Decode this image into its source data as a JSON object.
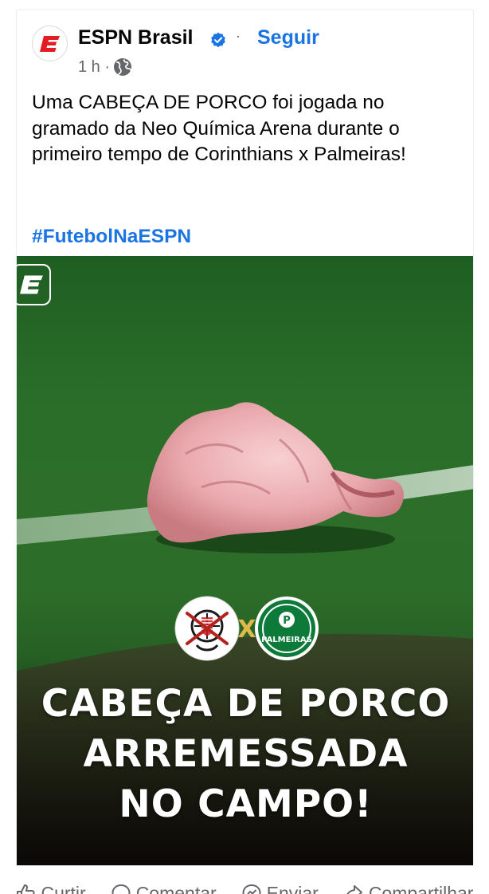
{
  "post": {
    "page_name": "ESPN Brasil",
    "separator": "·",
    "follow_label": "Seguir",
    "time": "1 h ·",
    "body_text": "Uma CABEÇA DE PORCO foi jogada no gramado da Neo Química Arena durante o primeiro tempo de Corinthians x Palmeiras!",
    "hashtag": "#FutebolNaESPN"
  },
  "media": {
    "headline_line1": "CABEÇA DE PORCO",
    "headline_line2": "ARREMESSADA",
    "headline_line3": "NO CAMPO!",
    "versus": "X",
    "palmeiras_crest_text": "PALMEIRAS"
  },
  "actions": {
    "like": "Curtir",
    "comment": "Comentar",
    "send": "Enviar",
    "share": "Compartilhar"
  },
  "colors": {
    "brand_blue": "#1b74e4",
    "espn_red": "#e31b23",
    "muted": "#65676b"
  },
  "icons": [
    "espn-logo-icon",
    "verified-badge-icon",
    "globe-icon",
    "like-icon",
    "comment-icon",
    "send-icon",
    "share-icon"
  ]
}
